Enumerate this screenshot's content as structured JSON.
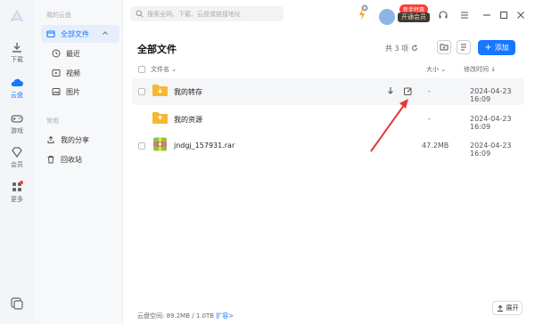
{
  "rail": {
    "items": [
      {
        "label": "下载",
        "icon": "download-icon"
      },
      {
        "label": "云盘",
        "icon": "cloud-icon",
        "active": true
      },
      {
        "label": "游戏",
        "icon": "gamepad-icon"
      },
      {
        "label": "会员",
        "icon": "diamond-icon"
      },
      {
        "label": "更多",
        "icon": "grid-icon"
      }
    ]
  },
  "sidebar": {
    "section_mine": "我的云盘",
    "all_files": "全部文件",
    "recent": "最近",
    "video": "视频",
    "image": "图片",
    "section_common": "常用",
    "my_share": "我的分享",
    "recycle": "回收站"
  },
  "search": {
    "placeholder": "搜索全网、下载、云盘或链接地址"
  },
  "vip": {
    "button": "开通会员",
    "tag": "新手特惠"
  },
  "main": {
    "title": "全部文件",
    "count": "共 3 项",
    "add_label": "添加",
    "columns": {
      "name": "文件名",
      "size": "大小",
      "modified": "修改时间"
    }
  },
  "rows": [
    {
      "name": "我的转存",
      "size": "-",
      "date": "2024-04-23 16:09"
    },
    {
      "name": "我的资源",
      "size": "-",
      "date": "2024-04-23 16:09"
    },
    {
      "name": "jndgj_157931.rar",
      "size": "47.2MB",
      "date": "2024-04-23 16:09"
    }
  ],
  "footer": {
    "space": "云盘空间: 89.2MB / 1.0TB",
    "expand_link": "扩容>"
  },
  "expand_button": "展开",
  "colors": {
    "accent": "#1677ff",
    "folder": "#f7b731",
    "annotation": "#e53935"
  }
}
